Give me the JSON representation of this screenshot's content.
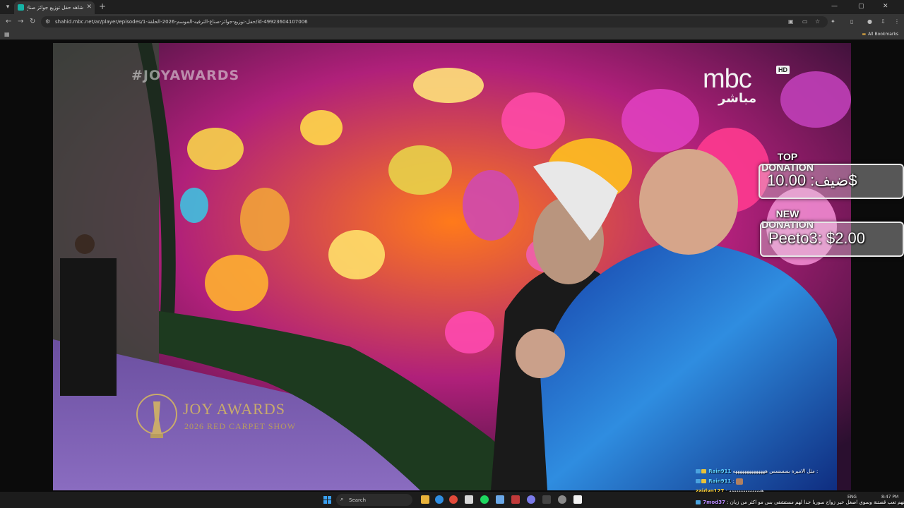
{
  "browser": {
    "tab_title": "شاهد حفل توزيع جوائز صناع الت...",
    "new_tab_symbol": "+",
    "close_symbol": "✕",
    "url": "shahid.mbc.net/ar/player/episodes/حفل-توزيع-جوائز-صناع-الترفيه-الموسم-2026-الحلقة-1/id-49923604107006",
    "bookmarks_label": "All Bookmarks"
  },
  "video": {
    "hashtag": "#JOYAWARDS",
    "channel_logo": "mbc",
    "channel_hd": "HD",
    "channel_live": "مباشر",
    "show_logo_title": "JOY AWARDS",
    "show_logo_subtitle": "2026 RED CARPET SHOW"
  },
  "donations": {
    "top_caption_1": "TOP",
    "top_caption_2": "DONATION",
    "top_value": "ضيف: 10.00$",
    "new_caption_1": "NEW",
    "new_caption_2": "DONATION",
    "new_value": "Peeto3: $2.00"
  },
  "chat": [
    {
      "name": "Rain911",
      "message": "مثل الاميرة بسسسس ههههههههههههههه :",
      "badge": "blue"
    },
    {
      "name": "Rain911",
      "message": ":",
      "badge": "yellow",
      "emote": true
    },
    {
      "name": "zaidyg127",
      "message": ": ههههههههههههههه",
      "badge": ""
    },
    {
      "name": "7mod37",
      "message": ": لأنهم تعب قصتنة وسوي اصغل خير زواج سوريا جدا لهم مستشفى بس مو اكثر من زيان",
      "badge": "blue"
    }
  ],
  "taskbar": {
    "search_placeholder": "Search",
    "time": "8:47 PM",
    "lang": "ENG"
  },
  "colors": {
    "chrome_dark": "#1f1f1f",
    "chrome_mid": "#353535",
    "joy_gold": "#c9ab6b",
    "jacket_blue": "#1f5fd0"
  },
  "icons": [
    "back-icon",
    "forward-icon",
    "reload-icon",
    "site-info-icon",
    "bookmark-star-icon",
    "extensions-icon",
    "profile-icon",
    "menu-icon",
    "windows-icon",
    "search-icon"
  ]
}
